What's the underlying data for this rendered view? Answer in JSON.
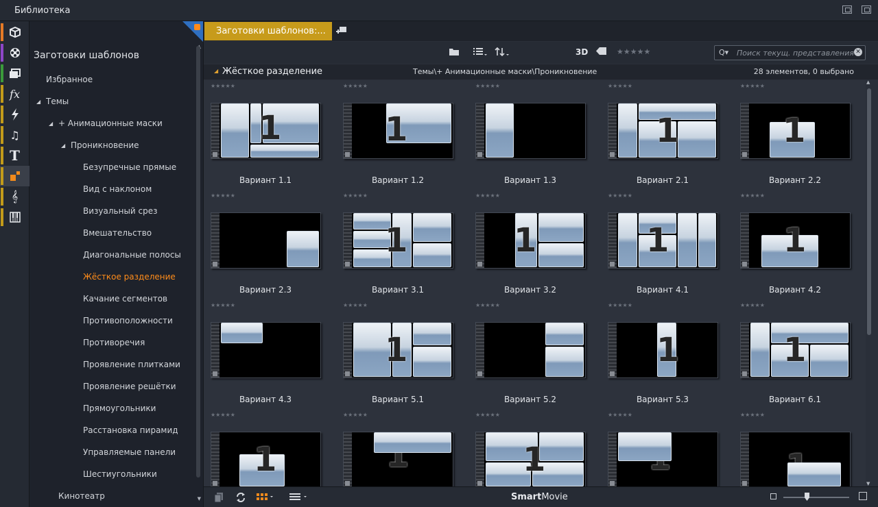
{
  "window": {
    "title": "Библиотека"
  },
  "rail": {
    "items": [
      {
        "icon": "box-icon",
        "stripe": "#e57a26"
      },
      {
        "icon": "film-reel-icon",
        "stripe": "#8e46c8"
      },
      {
        "icon": "stack-icon",
        "stripe": "#3b9a3b"
      },
      {
        "icon": "fx-icon",
        "stripe": "#c39b1a"
      },
      {
        "icon": "lightning-icon",
        "stripe": "#c39b1a"
      },
      {
        "icon": "music-note-icon",
        "stripe": "#c39b1a"
      },
      {
        "icon": "text-icon",
        "stripe": "#c39b1a"
      },
      {
        "icon": "template-icon",
        "stripe": "#c39b1a"
      },
      {
        "icon": "treble-clef-icon",
        "stripe": "#c39b1a"
      },
      {
        "icon": "piano-icon",
        "stripe": "#c39b1a"
      }
    ],
    "fx_label": "fx",
    "text_label": "T"
  },
  "tree": {
    "heading": "Заготовки шаблонов",
    "nodes": [
      {
        "label": "Избранное"
      },
      {
        "label": "Темы"
      },
      {
        "label": "+ Анимационные маски"
      },
      {
        "label": "Проникновение"
      },
      {
        "label": "Безупречные прямые"
      },
      {
        "label": "Вид с наклоном"
      },
      {
        "label": "Визуальный срез"
      },
      {
        "label": "Вмешательство"
      },
      {
        "label": "Диагональные полосы"
      },
      {
        "label": "Жёсткое разделение"
      },
      {
        "label": "Качание сегментов"
      },
      {
        "label": "Противоположности"
      },
      {
        "label": "Противоречия"
      },
      {
        "label": "Проявление плитками"
      },
      {
        "label": "Проявление решётки"
      },
      {
        "label": "Прямоугольники"
      },
      {
        "label": "Расстановка пирамид"
      },
      {
        "label": "Управляемые панели"
      },
      {
        "label": "Шестиугольники"
      },
      {
        "label": "Кинотеатр"
      }
    ]
  },
  "tabs": {
    "active": "Заготовки шаблонов:..."
  },
  "toolbar": {
    "three_d": "3D",
    "stars": "★★★★★",
    "search_placeholder": "Поиск текущ. представления"
  },
  "info": {
    "name": "Жёсткое разделение",
    "path": "Темы\\+ Анимационные маски\\Проникновение",
    "count": "28 элементов, 0 выбрано"
  },
  "items": [
    {
      "label": "Вариант 1.1",
      "stars": "★★★★★"
    },
    {
      "label": "Вариант 1.2",
      "stars": "★★★★★"
    },
    {
      "label": "Вариант 1.3",
      "stars": "★★★★★"
    },
    {
      "label": "Вариант 2.1",
      "stars": "★★★★★"
    },
    {
      "label": "Вариант 2.2",
      "stars": "★★★★★"
    },
    {
      "label": "Вариант 2.3",
      "stars": "★★★★★"
    },
    {
      "label": "Вариант 3.1",
      "stars": "★★★★★"
    },
    {
      "label": "Вариант 3.2",
      "stars": "★★★★★"
    },
    {
      "label": "Вариант 4.1",
      "stars": "★★★★★"
    },
    {
      "label": "Вариант 4.2",
      "stars": "★★★★★"
    },
    {
      "label": "Вариант 4.3",
      "stars": "★★★★★"
    },
    {
      "label": "Вариант 5.1",
      "stars": "★★★★★"
    },
    {
      "label": "Вариант 5.2",
      "stars": "★★★★★"
    },
    {
      "label": "Вариант 5.3",
      "stars": "★★★★★"
    },
    {
      "label": "Вариант 6.1",
      "stars": "★★★★★"
    },
    {
      "label": "",
      "stars": "★★★★★"
    },
    {
      "label": "",
      "stars": "★★★★★"
    },
    {
      "label": "",
      "stars": "★★★★★"
    },
    {
      "label": "",
      "stars": "★★★★★"
    },
    {
      "label": "",
      "stars": "★★★★★"
    }
  ],
  "thumb_numeral": "1",
  "bottom": {
    "brand_bold": "Smart",
    "brand_rest": "Movie"
  },
  "colors": {
    "accent": "#ff8c1a",
    "tab": "#c79b1b",
    "corner": "#2f6fc0"
  }
}
